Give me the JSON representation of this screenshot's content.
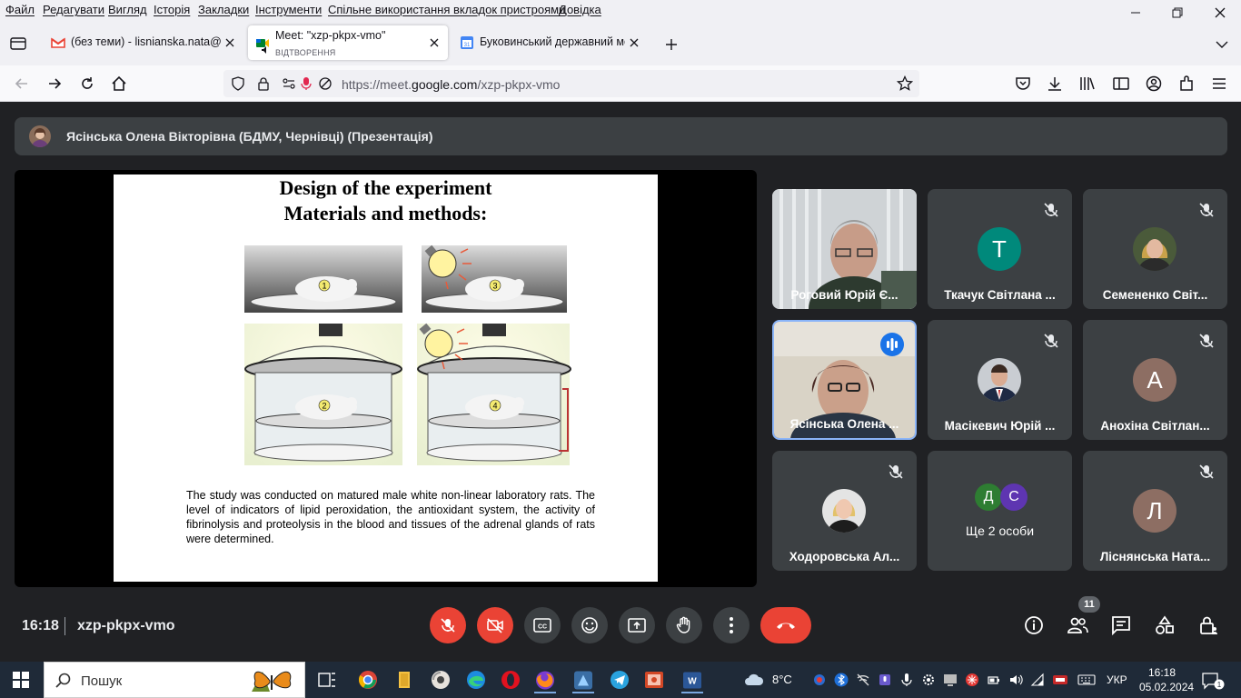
{
  "menu": {
    "items": [
      "Файл",
      "Редагувати",
      "Вигляд",
      "Історія",
      "Закладки",
      "Інструменти",
      "Спільне використання вкладок пристроями",
      "Довідка"
    ]
  },
  "tabs": [
    {
      "title": "(без теми) - lisnianska.nata@bs",
      "favicon": "gmail-icon"
    },
    {
      "title": "Meet: \"xzp-pkpx-vmo\"",
      "subtitle": "ВІДТВОРЕННЯ",
      "favicon": "meet-icon",
      "active": true
    },
    {
      "title": "Буковинський державний мед",
      "favicon": "calendar-icon"
    }
  ],
  "url": {
    "prefix": "https://meet.",
    "domain": "google.com",
    "path": "/xzp-pkpx-vmo"
  },
  "presenter": {
    "label": "Ясінська Олена Вікторівна (БДМУ, Чернівці) (Презентація)"
  },
  "slide": {
    "title_line1": "Design of the experiment",
    "title_line2": "Materials and methods:",
    "paragraph": "The study was conducted on matured male white non-linear laboratory rats. The level of indicators of lipid peroxidation, the antioxidant system, the activity of fibrinolysis and proteolysis in the blood and tissues of the adrenal glands of rats were determined.",
    "panel_numbers": [
      "1",
      "3",
      "2",
      "4"
    ]
  },
  "participants": [
    {
      "name": "Роговий Юрій Є...",
      "type": "video"
    },
    {
      "name": "Ткачук Світлана ...",
      "type": "initial",
      "initial": "Т",
      "color": "#00897b",
      "muted": true
    },
    {
      "name": "Семененко Світ...",
      "type": "photo",
      "muted": true
    },
    {
      "name": "Ясінська Олена ...",
      "type": "video",
      "speaking": true
    },
    {
      "name": "Масікевич Юрій ...",
      "type": "photo",
      "muted": true
    },
    {
      "name": "Анохіна Світлан...",
      "type": "initial",
      "initial": "А",
      "color": "#8d6e63",
      "muted": true
    },
    {
      "name": "Ходоровська Ал...",
      "type": "photo",
      "muted": true
    },
    {
      "name": "Ще 2 особи",
      "type": "group",
      "initials": [
        "Д",
        "С"
      ],
      "colors": [
        "#2e7d32",
        "#5e35b1"
      ]
    },
    {
      "name": "Ліснянська Ната...",
      "type": "initial",
      "initial": "Л",
      "color": "#8d6e63",
      "muted": true
    }
  ],
  "controls": {
    "time": "16:18",
    "meeting_code": "xzp-pkpx-vmo",
    "people_count": "11"
  },
  "taskbar": {
    "search_placeholder": "Пошук",
    "weather": "8°C",
    "language": "УКР",
    "time": "16:18",
    "date": "05.02.2024",
    "notifications": "1"
  }
}
